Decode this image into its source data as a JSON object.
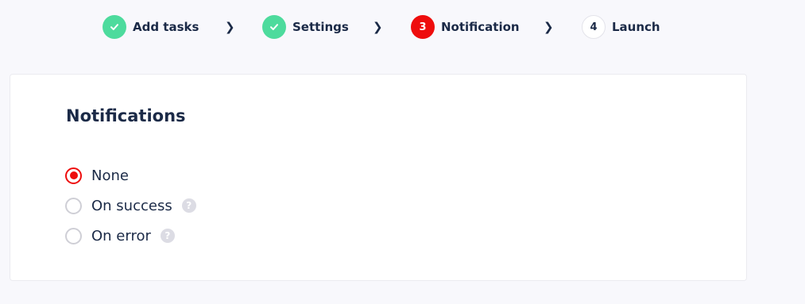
{
  "stepper": {
    "steps": [
      {
        "label": "Add tasks",
        "badge": "",
        "state": "done",
        "icon": "checkmark-icon"
      },
      {
        "label": "Settings",
        "badge": "",
        "state": "done",
        "icon": "checkmark-icon"
      },
      {
        "label": "Notification",
        "badge": "3",
        "state": "active"
      },
      {
        "label": "Launch",
        "badge": "4",
        "state": "todo"
      }
    ],
    "separator_icon": "chevron-right-icon",
    "separator_glyph": "❯"
  },
  "card": {
    "title": "Notifications",
    "options": [
      {
        "label": "None",
        "selected": true,
        "has_help": false
      },
      {
        "label": "On success",
        "selected": false,
        "has_help": true
      },
      {
        "label": "On error",
        "selected": false,
        "has_help": true
      }
    ],
    "help_glyph": "?"
  },
  "colors": {
    "done": "#4ddb9d",
    "active": "#ee0d0d",
    "text": "#1b2a47",
    "background": "#f8f8fc",
    "help_icon": "#dcdce4"
  }
}
